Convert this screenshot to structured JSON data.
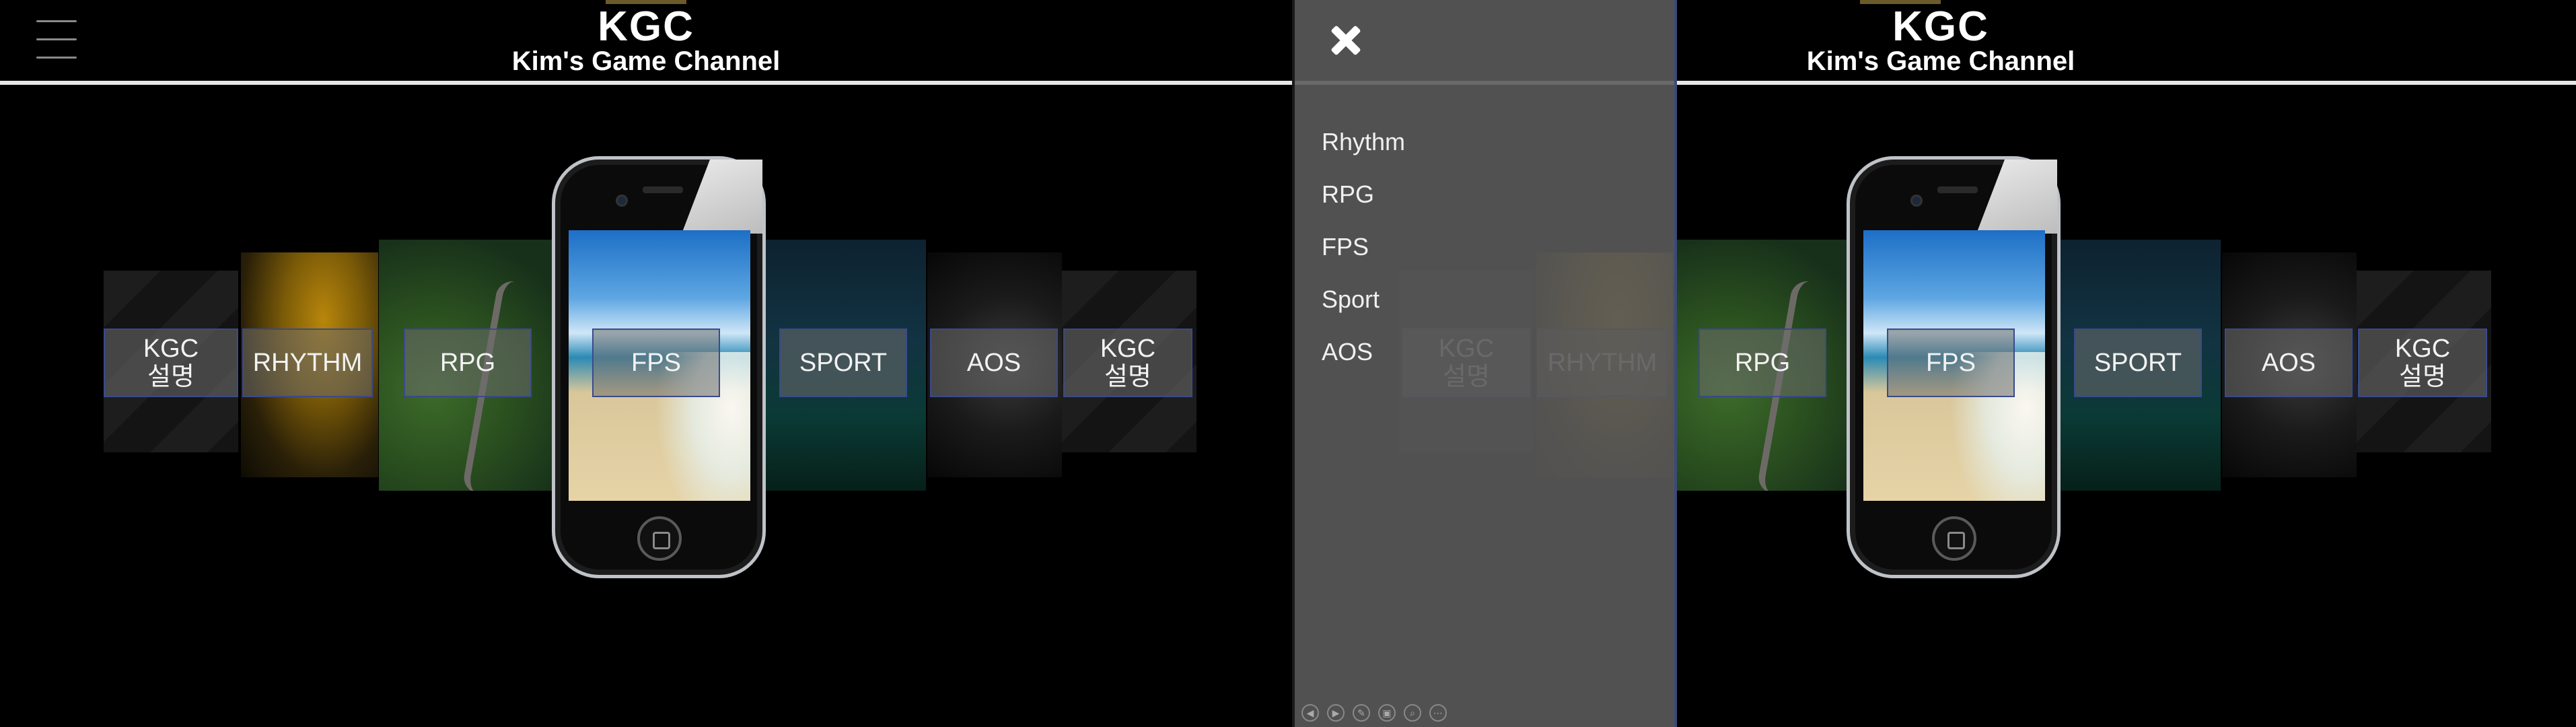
{
  "header": {
    "title": "KGC",
    "subtitle": "Kim's Game Channel"
  },
  "carousel": {
    "cards": [
      {
        "label": "KGC\n설명",
        "name": "card-kgc-left"
      },
      {
        "label": "RHYTHM",
        "name": "card-rhythm"
      },
      {
        "label": "RPG",
        "name": "card-rpg"
      },
      {
        "label": "FPS",
        "name": "card-fps"
      },
      {
        "label": "SPORT",
        "name": "card-sport"
      },
      {
        "label": "AOS",
        "name": "card-aos"
      },
      {
        "label": "KGC\n설명",
        "name": "card-kgc-right"
      }
    ]
  },
  "menu": {
    "items": [
      "Rhythm",
      "RPG",
      "FPS",
      "Sport",
      "AOS"
    ]
  },
  "colors": {
    "background": "#000000",
    "header_line": "#e8e8e8",
    "drawer": "#5a5a5a",
    "label_border": "#3a4a8a"
  },
  "icons": {
    "menu": "hamburger-icon",
    "close": "close-icon",
    "home": "home-button-icon"
  }
}
